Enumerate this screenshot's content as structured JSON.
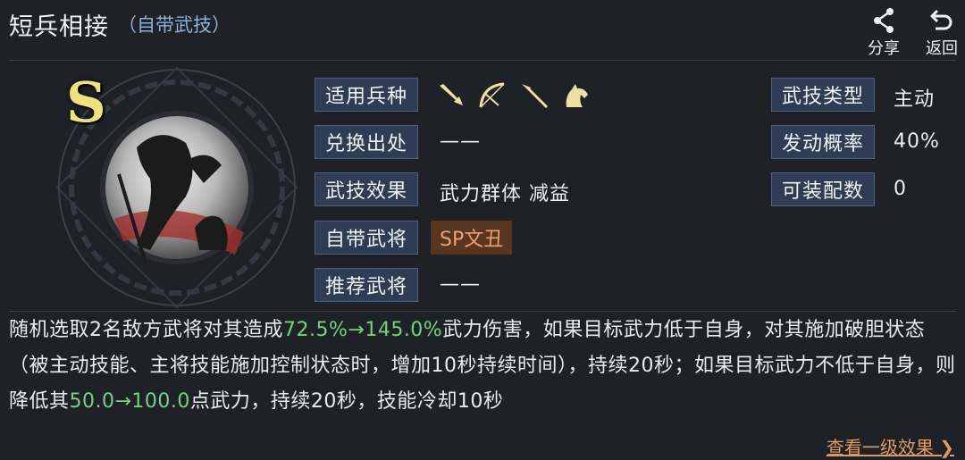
{
  "header": {
    "title": "短兵相接",
    "subtitle": "（自带武技）",
    "share_label": "分享",
    "back_label": "返回"
  },
  "skill": {
    "grade": "S",
    "troops_label": "适用兵种",
    "troop_icons": [
      "sword-icon",
      "bow-icon",
      "spear-icon",
      "horse-icon"
    ],
    "exchange_label": "兑换出处",
    "exchange_value": "——",
    "effect_label": "武技效果",
    "effect_value": "武力群体 减益",
    "builtin_label": "自带武将",
    "builtin_value": "SP文丑",
    "recommend_label": "推荐武将",
    "recommend_value": "——",
    "type_label": "武技类型",
    "type_value": "主动",
    "chance_label": "发动概率",
    "chance_value": "40%",
    "equip_label": "可装配数",
    "equip_value": "0"
  },
  "description": {
    "t1": "随机选取2名敌方武将对其造成",
    "h1": "72.5%→145.0%",
    "t2": "武力伤害，如果目标武力低于自身，对其施加破胆状态（被主动技能、主将技能施加控制状态时，增加10秒持续时间），持续20秒；如果目标武力不低于自身，则降低其",
    "h2": "50.0→100.0",
    "t3": "点武力，持续20秒，技能冷却10秒"
  },
  "footer": {
    "more_label": "查看一级效果 ❯"
  },
  "colors": {
    "background": "#1e2126",
    "tag_bg": "#2e3d55",
    "highlight": "#6fd47a",
    "link": "#e29a5c",
    "grade": "#f0e27a"
  }
}
